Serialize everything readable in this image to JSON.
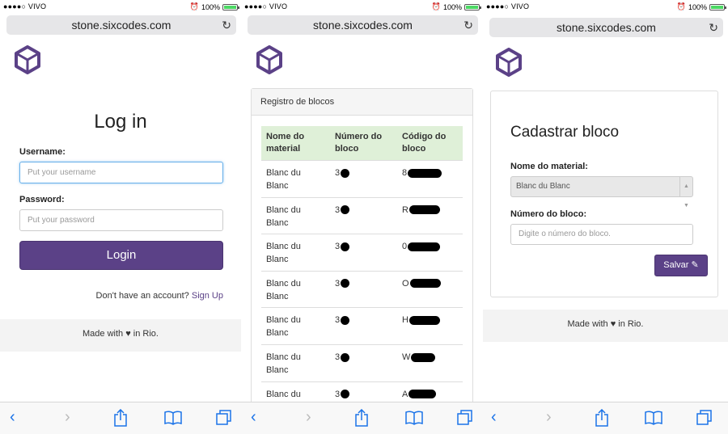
{
  "status_bar": {
    "carrier": "●●●●○ VIVO",
    "battery": "100%"
  },
  "url": "stone.sixcodes.com",
  "colors": {
    "brand": "#5b4187",
    "table_header": "#dff0d8"
  },
  "toolbar_icons": [
    "back-icon",
    "forward-icon",
    "share-icon",
    "bookmarks-icon",
    "tabs-icon"
  ],
  "login": {
    "title": "Log in",
    "username_label": "Username:",
    "username_placeholder": "Put your username",
    "password_label": "Password:",
    "password_placeholder": "Put your password",
    "login_button": "Login",
    "no_account_text": "Don't have an account?",
    "signup_link": "Sign Up"
  },
  "footer": {
    "made_with": "Made with",
    "heart": "♥",
    "in_rio": "in Rio."
  },
  "blocks": {
    "panel_title": "Registro de blocos",
    "headers": [
      "Nome do material",
      "Número do bloco",
      "Código do bloco"
    ],
    "rows": [
      {
        "material": "Blanc du Blanc",
        "number_prefix": "3",
        "code_prefix": "8"
      },
      {
        "material": "Blanc du Blanc",
        "number_prefix": "3",
        "code_prefix": "R"
      },
      {
        "material": "Blanc du Blanc",
        "number_prefix": "3",
        "code_prefix": "0"
      },
      {
        "material": "Blanc du Blanc",
        "number_prefix": "3",
        "code_prefix": "O"
      },
      {
        "material": "Blanc du Blanc",
        "number_prefix": "3",
        "code_prefix": "H"
      },
      {
        "material": "Blanc du Blanc",
        "number_prefix": "3",
        "code_prefix": "W"
      },
      {
        "material": "Blanc du Blanc",
        "number_prefix": "3",
        "code_prefix": "A"
      }
    ]
  },
  "cadastro": {
    "title": "Cadastrar bloco",
    "material_label": "Nome do material:",
    "material_selected": "Blanc du Blanc",
    "number_label": "Número do bloco:",
    "number_placeholder": "Digite o número do bloco.",
    "save_button": "Salvar"
  }
}
